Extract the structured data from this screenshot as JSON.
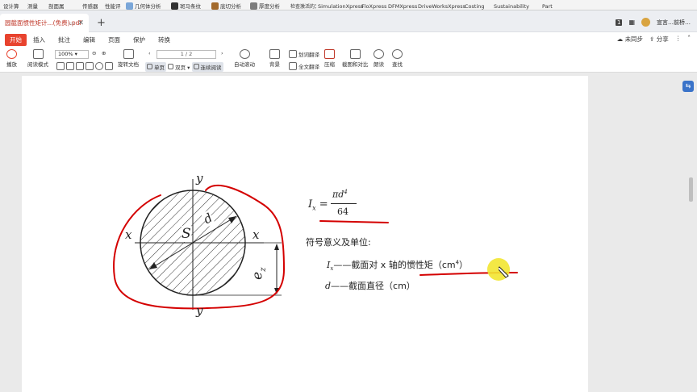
{
  "sw_strip": {
    "items": [
      {
        "label": "设计算",
        "x_hint": "a"
      },
      {
        "label": "测量",
        "x_hint": "b"
      },
      {
        "label": "剖面属",
        "x_hint": "c"
      },
      {
        "label": "传感器",
        "x_hint": "d"
      },
      {
        "label": "性能评",
        "x_hint": "e"
      },
      {
        "label": "几何体分析",
        "x_hint": "f"
      },
      {
        "label": "斑马条纹",
        "x_hint": "g"
      },
      {
        "label": "底切分析",
        "x_hint": "h"
      },
      {
        "label": "厚度分析",
        "x_hint": "i"
      },
      {
        "label": "检查激活的文档",
        "x_hint": "j"
      },
      {
        "label": "SimulationXpress",
        "x_hint": "k"
      },
      {
        "label": "FloXpress",
        "x_hint": "l"
      },
      {
        "label": "DFMXpress",
        "x_hint": "m"
      },
      {
        "label": "DriveWorksXpress",
        "x_hint": "n"
      },
      {
        "label": "Costing",
        "x_hint": "o"
      },
      {
        "label": "Sustainability",
        "x_hint": "p"
      },
      {
        "label": "Part",
        "x_hint": "q"
      }
    ]
  },
  "tabbar": {
    "doc_tab_title": "圆截面惯性矩计...(免费).pdf",
    "new_tab": "+",
    "badge": "1",
    "account": "宣言…前桥…"
  },
  "menu": {
    "items": [
      "开始",
      "插入",
      "批注",
      "编辑",
      "页面",
      "保护",
      "转换"
    ],
    "right": [
      "未同步",
      "分享"
    ]
  },
  "toolbar": {
    "play": "播放",
    "reading_mode": "阅读模式",
    "zoom": "100%",
    "rotate": "旋转文档",
    "single": "单页",
    "double": "双页",
    "continuous": "连续阅读",
    "auto_scroll": "自动滚动",
    "background": "背景",
    "translate_word": "划词翻译",
    "translate_full": "全文翻译",
    "compress": "压缩",
    "screenshot": "截图和对比",
    "read_aloud": "朗读",
    "find": "查找",
    "page_indicator": "1 / 2"
  },
  "document": {
    "formula_lhs": "I",
    "formula_sub": "x",
    "formula_num": "πd",
    "formula_num_exp": "4",
    "formula_den": "64",
    "symbol_title": "符号意义及单位:",
    "def1_symbol": "I",
    "def1_sub": "x",
    "def1_text": "——截面对 x 轴的惯性矩（cm",
    "def1_exp": "4",
    "def1_close": "）",
    "def2_symbol": "d",
    "def2_text": "——截面直径（cm）",
    "diagram": {
      "y_top": "y",
      "y_bottom": "y",
      "x_left": "x",
      "x_right": "x",
      "center": "S",
      "diameter": "d",
      "ez": "e",
      "ez_sub": "z"
    }
  },
  "colors": {
    "accent": "#e8432e",
    "ink_red": "#d40000",
    "highlight": "#f2e531"
  }
}
